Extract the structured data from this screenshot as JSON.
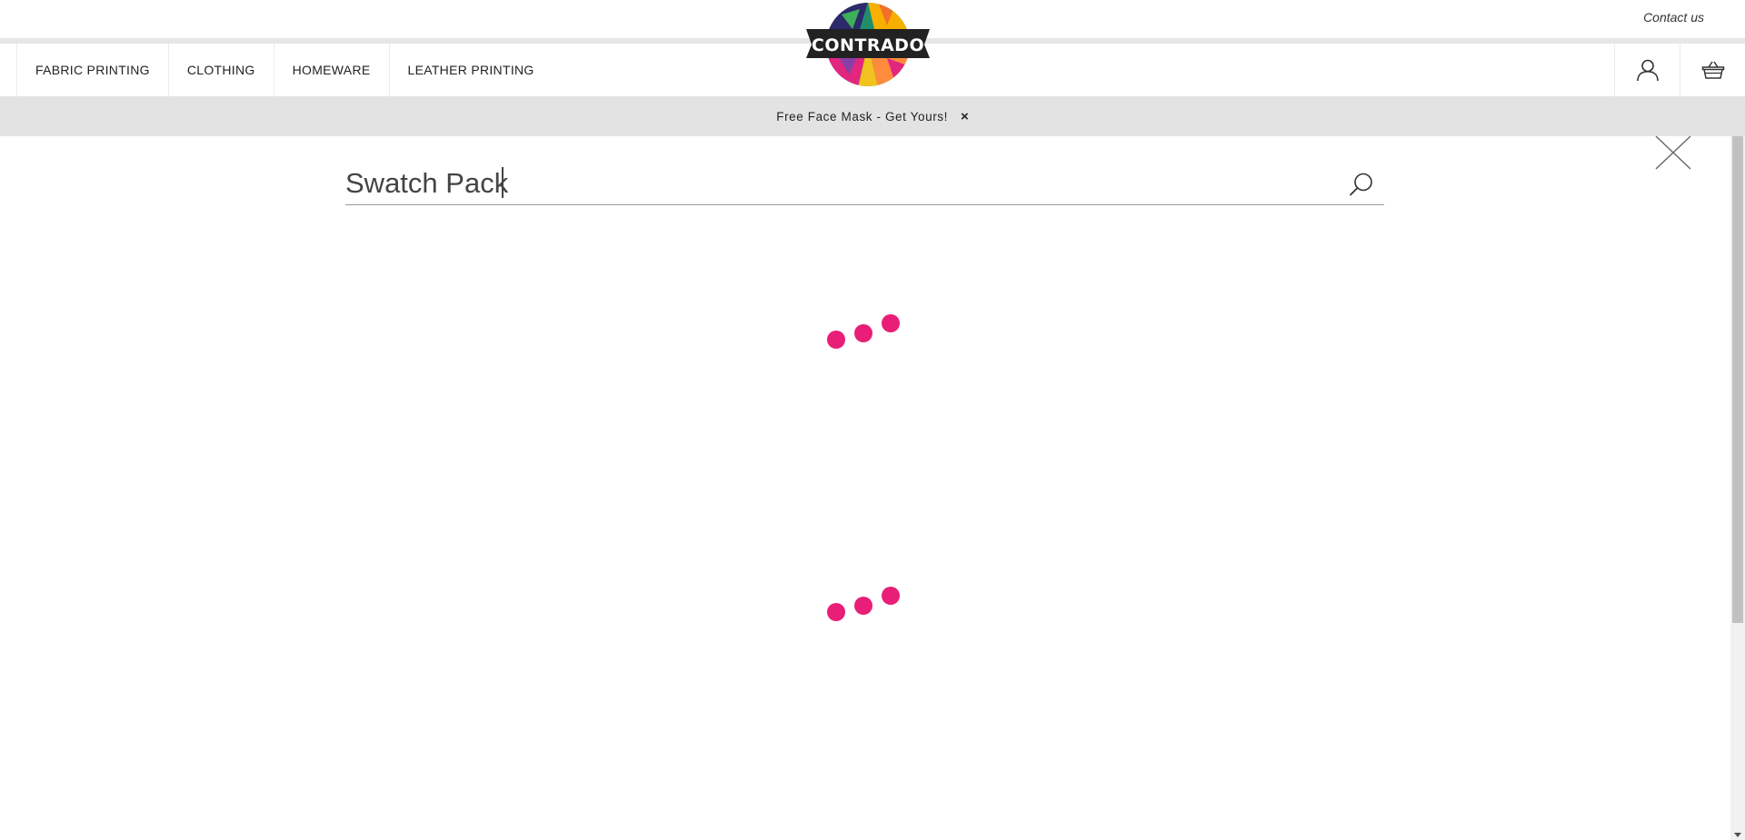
{
  "header": {
    "contact_label": "Contact us",
    "logo_text": "CONTRADO"
  },
  "nav": {
    "items": [
      {
        "label": "FABRIC PRINTING"
      },
      {
        "label": "CLOTHING"
      },
      {
        "label": "HOMEWARE"
      },
      {
        "label": "LEATHER PRINTING"
      }
    ],
    "icons": [
      "user-icon",
      "basket-icon"
    ]
  },
  "promo": {
    "text": "Free Face Mask - Get Yours!",
    "close_symbol": "×"
  },
  "search": {
    "value": "Swatch Pack",
    "icons": [
      "close-icon",
      "search-icon"
    ],
    "loader_color": "#e91e78"
  },
  "colors": {
    "accent": "#e91e78",
    "promo_bg": "#e3e3e3"
  }
}
